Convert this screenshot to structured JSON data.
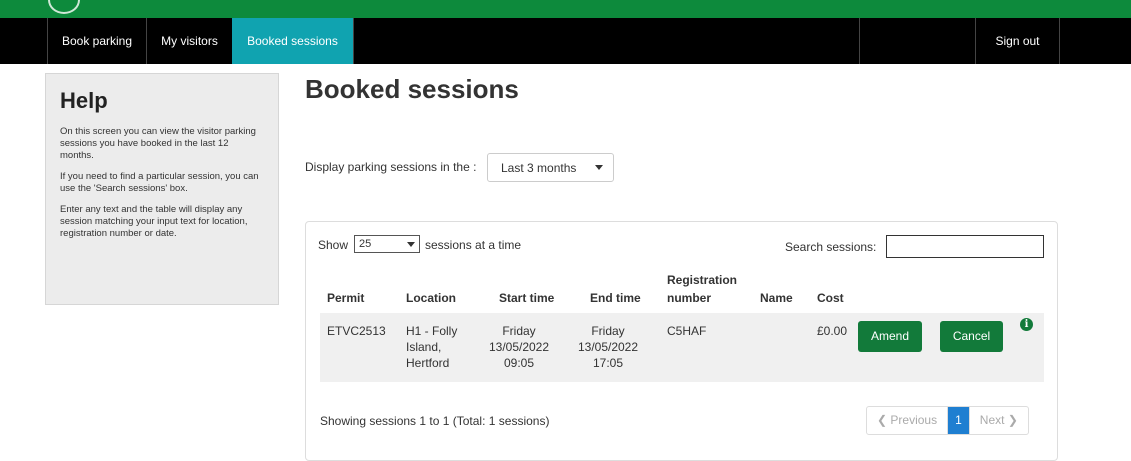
{
  "nav": {
    "items": [
      {
        "label": "Book parking",
        "active": false
      },
      {
        "label": "My visitors",
        "active": false
      },
      {
        "label": "Booked sessions",
        "active": true
      }
    ],
    "sign_out": "Sign out"
  },
  "help": {
    "title": "Help",
    "paragraphs": [
      "On this screen you can view the visitor parking sessions you have booked in the last 12 months.",
      "If you need to find a particular session, you can use the 'Search sessions' box.",
      "Enter any text and the table will display any session matching your input text for location, registration number or date."
    ]
  },
  "page": {
    "title": "Booked sessions",
    "period_label": "Display parking sessions in the :",
    "period_value": "Last 3 months"
  },
  "table": {
    "show_label": "Show",
    "show_value": "25",
    "show_suffix": "sessions at a time",
    "search_label": "Search sessions:",
    "headers": {
      "permit": "Permit",
      "location": "Location",
      "start_time": "Start time",
      "end_time": "End time",
      "registration_l1": "Registration",
      "registration_l2": "number",
      "name": "Name",
      "cost": "Cost"
    },
    "rows": [
      {
        "permit": "ETVC2513",
        "location": [
          "H1 - Folly",
          "Island,",
          "Hertford"
        ],
        "start": [
          "Friday",
          "13/05/2022",
          "09:05"
        ],
        "end": [
          "Friday",
          "13/05/2022",
          "17:05"
        ],
        "registration": "C5HAF",
        "name": "",
        "cost": "£0.00",
        "amend_label": "Amend",
        "cancel_label": "Cancel",
        "info_icon": "info-circle-icon"
      }
    ],
    "footer": "Showing sessions 1 to 1 (Total: 1 sessions)"
  },
  "pagination": {
    "previous": "Previous",
    "current": "1",
    "next": "Next"
  },
  "colors": {
    "brand_green": "#0d8a3c",
    "active_tab": "#10a3b0",
    "button_green": "#127a3a",
    "page_active": "#1f7fd1"
  }
}
